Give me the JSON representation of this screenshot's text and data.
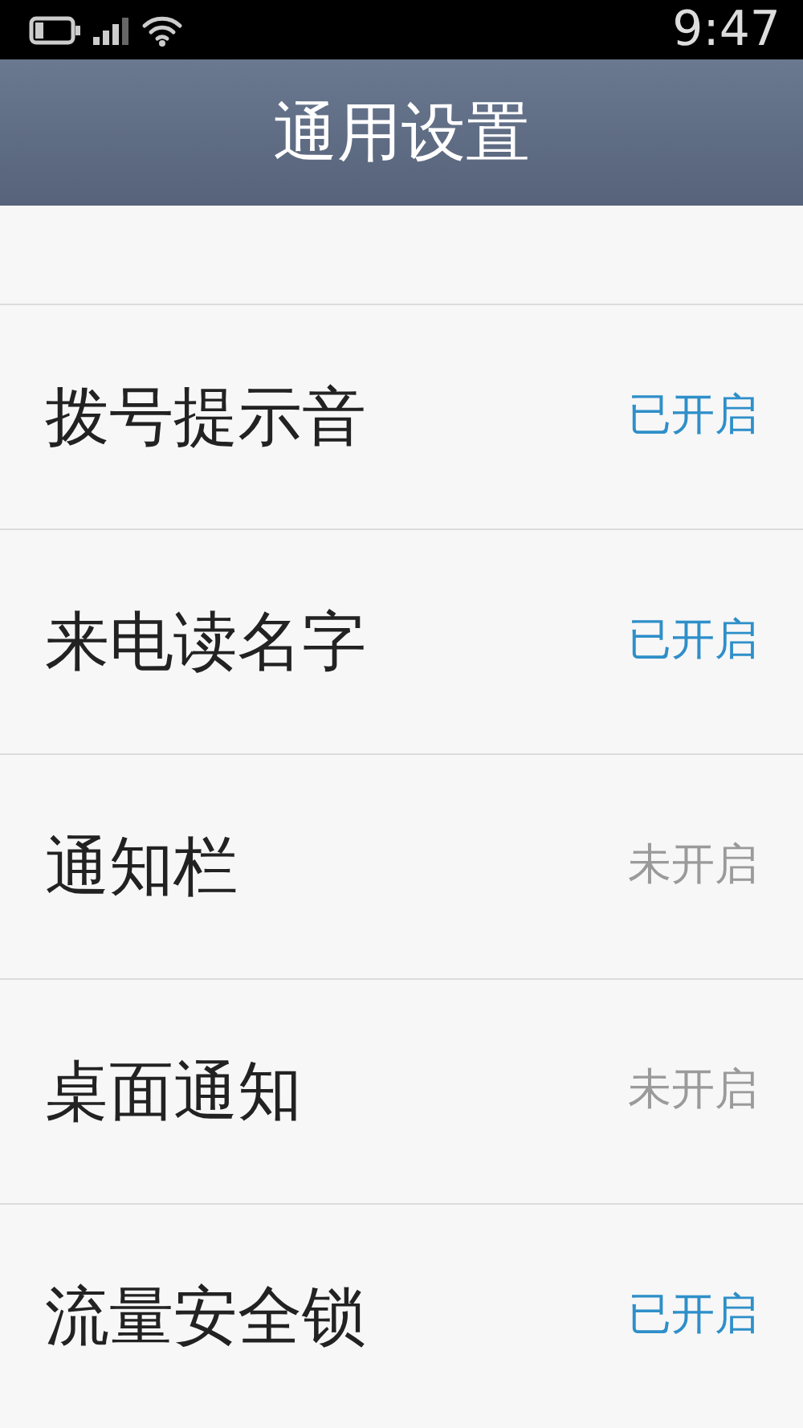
{
  "status_bar": {
    "time": "9:47"
  },
  "header": {
    "title": "通用设置"
  },
  "settings": [
    {
      "label": "拨号提示音",
      "status": "已开启",
      "enabled": true
    },
    {
      "label": "来电读名字",
      "status": "已开启",
      "enabled": true
    },
    {
      "label": "通知栏",
      "status": "未开启",
      "enabled": false
    },
    {
      "label": "桌面通知",
      "status": "未开启",
      "enabled": false
    },
    {
      "label": "流量安全锁",
      "status": "已开启",
      "enabled": true
    }
  ]
}
